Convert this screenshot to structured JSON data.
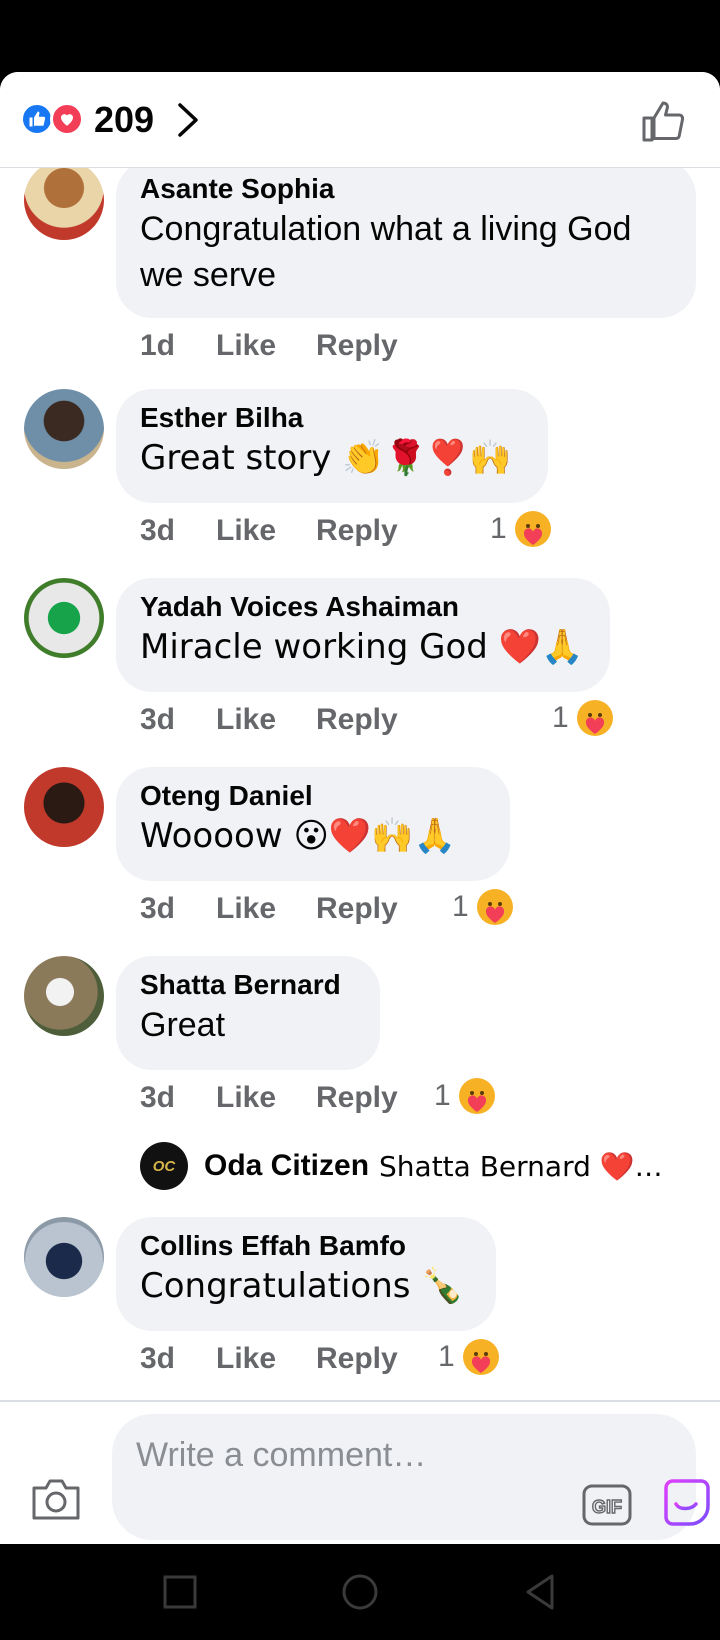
{
  "header": {
    "reaction_count": "209",
    "reaction_icons": [
      "like-icon",
      "love-icon"
    ]
  },
  "comments": [
    {
      "author": "Asante Sophia",
      "text": "Congratulation what a living God\nwe serve",
      "age": "1d",
      "like_label": "Like",
      "reply_label": "Reply",
      "reaction_count": ""
    },
    {
      "author": "Esther Bilha",
      "text": "Great story 👏🌹❣️🙌",
      "age": "3d",
      "like_label": "Like",
      "reply_label": "Reply",
      "reaction_count": "1"
    },
    {
      "author": "Yadah Voices Ashaiman",
      "text": "Miracle working God ❤️🙏",
      "age": "3d",
      "like_label": "Like",
      "reply_label": "Reply",
      "reaction_count": "1"
    },
    {
      "author": "Oteng Daniel",
      "text": "Woooow 😮❤️🙌🙏",
      "age": "3d",
      "like_label": "Like",
      "reply_label": "Reply",
      "reaction_count": "1"
    },
    {
      "author": "Shatta Bernard",
      "text": "Great",
      "age": "3d",
      "like_label": "Like",
      "reply_label": "Reply",
      "reaction_count": "1"
    },
    {
      "author": "Collins Effah Bamfo",
      "text": "Congratulations 🍾",
      "age": "3d",
      "like_label": "Like",
      "reply_label": "Reply",
      "reaction_count": "1"
    }
  ],
  "reply_preview": {
    "author": "Oda Citizen",
    "text": "Shatta Bernard ❤️❤️…",
    "avatar_initials": "OC"
  },
  "composer": {
    "placeholder": "Write a comment…",
    "gif_label": "GIF"
  },
  "colors": {
    "like_blue": "#1877f2",
    "love_red": "#f33e58",
    "care_yellow": "#f7b125",
    "bubble_bg": "#f0f2f5",
    "meta_gray": "#65676b"
  }
}
